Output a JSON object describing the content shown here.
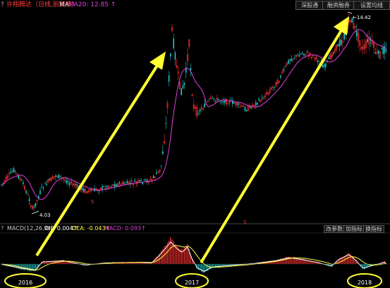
{
  "header": {
    "help": "?",
    "stock_label": "许翔腾达（日线,前复权）",
    "ma_label": "MA",
    "ma20_label": "MA20: 12.85",
    "ma20_arrow": "↑",
    "buttons": [
      "深股通",
      "融资融券",
      "设置均线"
    ]
  },
  "price_chart": {
    "low_label": "4.03",
    "high_label": "14.42",
    "markers": [
      "S",
      "S"
    ]
  },
  "macd_header": {
    "help": "?",
    "name": "MACD(12,26,9)",
    "dif_label": "DIF: 0.004",
    "dif_arrow": "↑",
    "dea_label": "DEA: -0.043",
    "dea_arrow": "↑",
    "macd_label": "MACD: 0.093",
    "macd_arrow": "↑",
    "buttons": [
      "改参数",
      "加指标",
      "换指标"
    ]
  },
  "years": [
    "2016",
    "2017",
    "2018"
  ],
  "colors": {
    "up": "#ff3030",
    "down": "#20c8c8",
    "ma": "#e040e0",
    "annotation": "#ffff33",
    "dea": "#ffff40"
  }
}
